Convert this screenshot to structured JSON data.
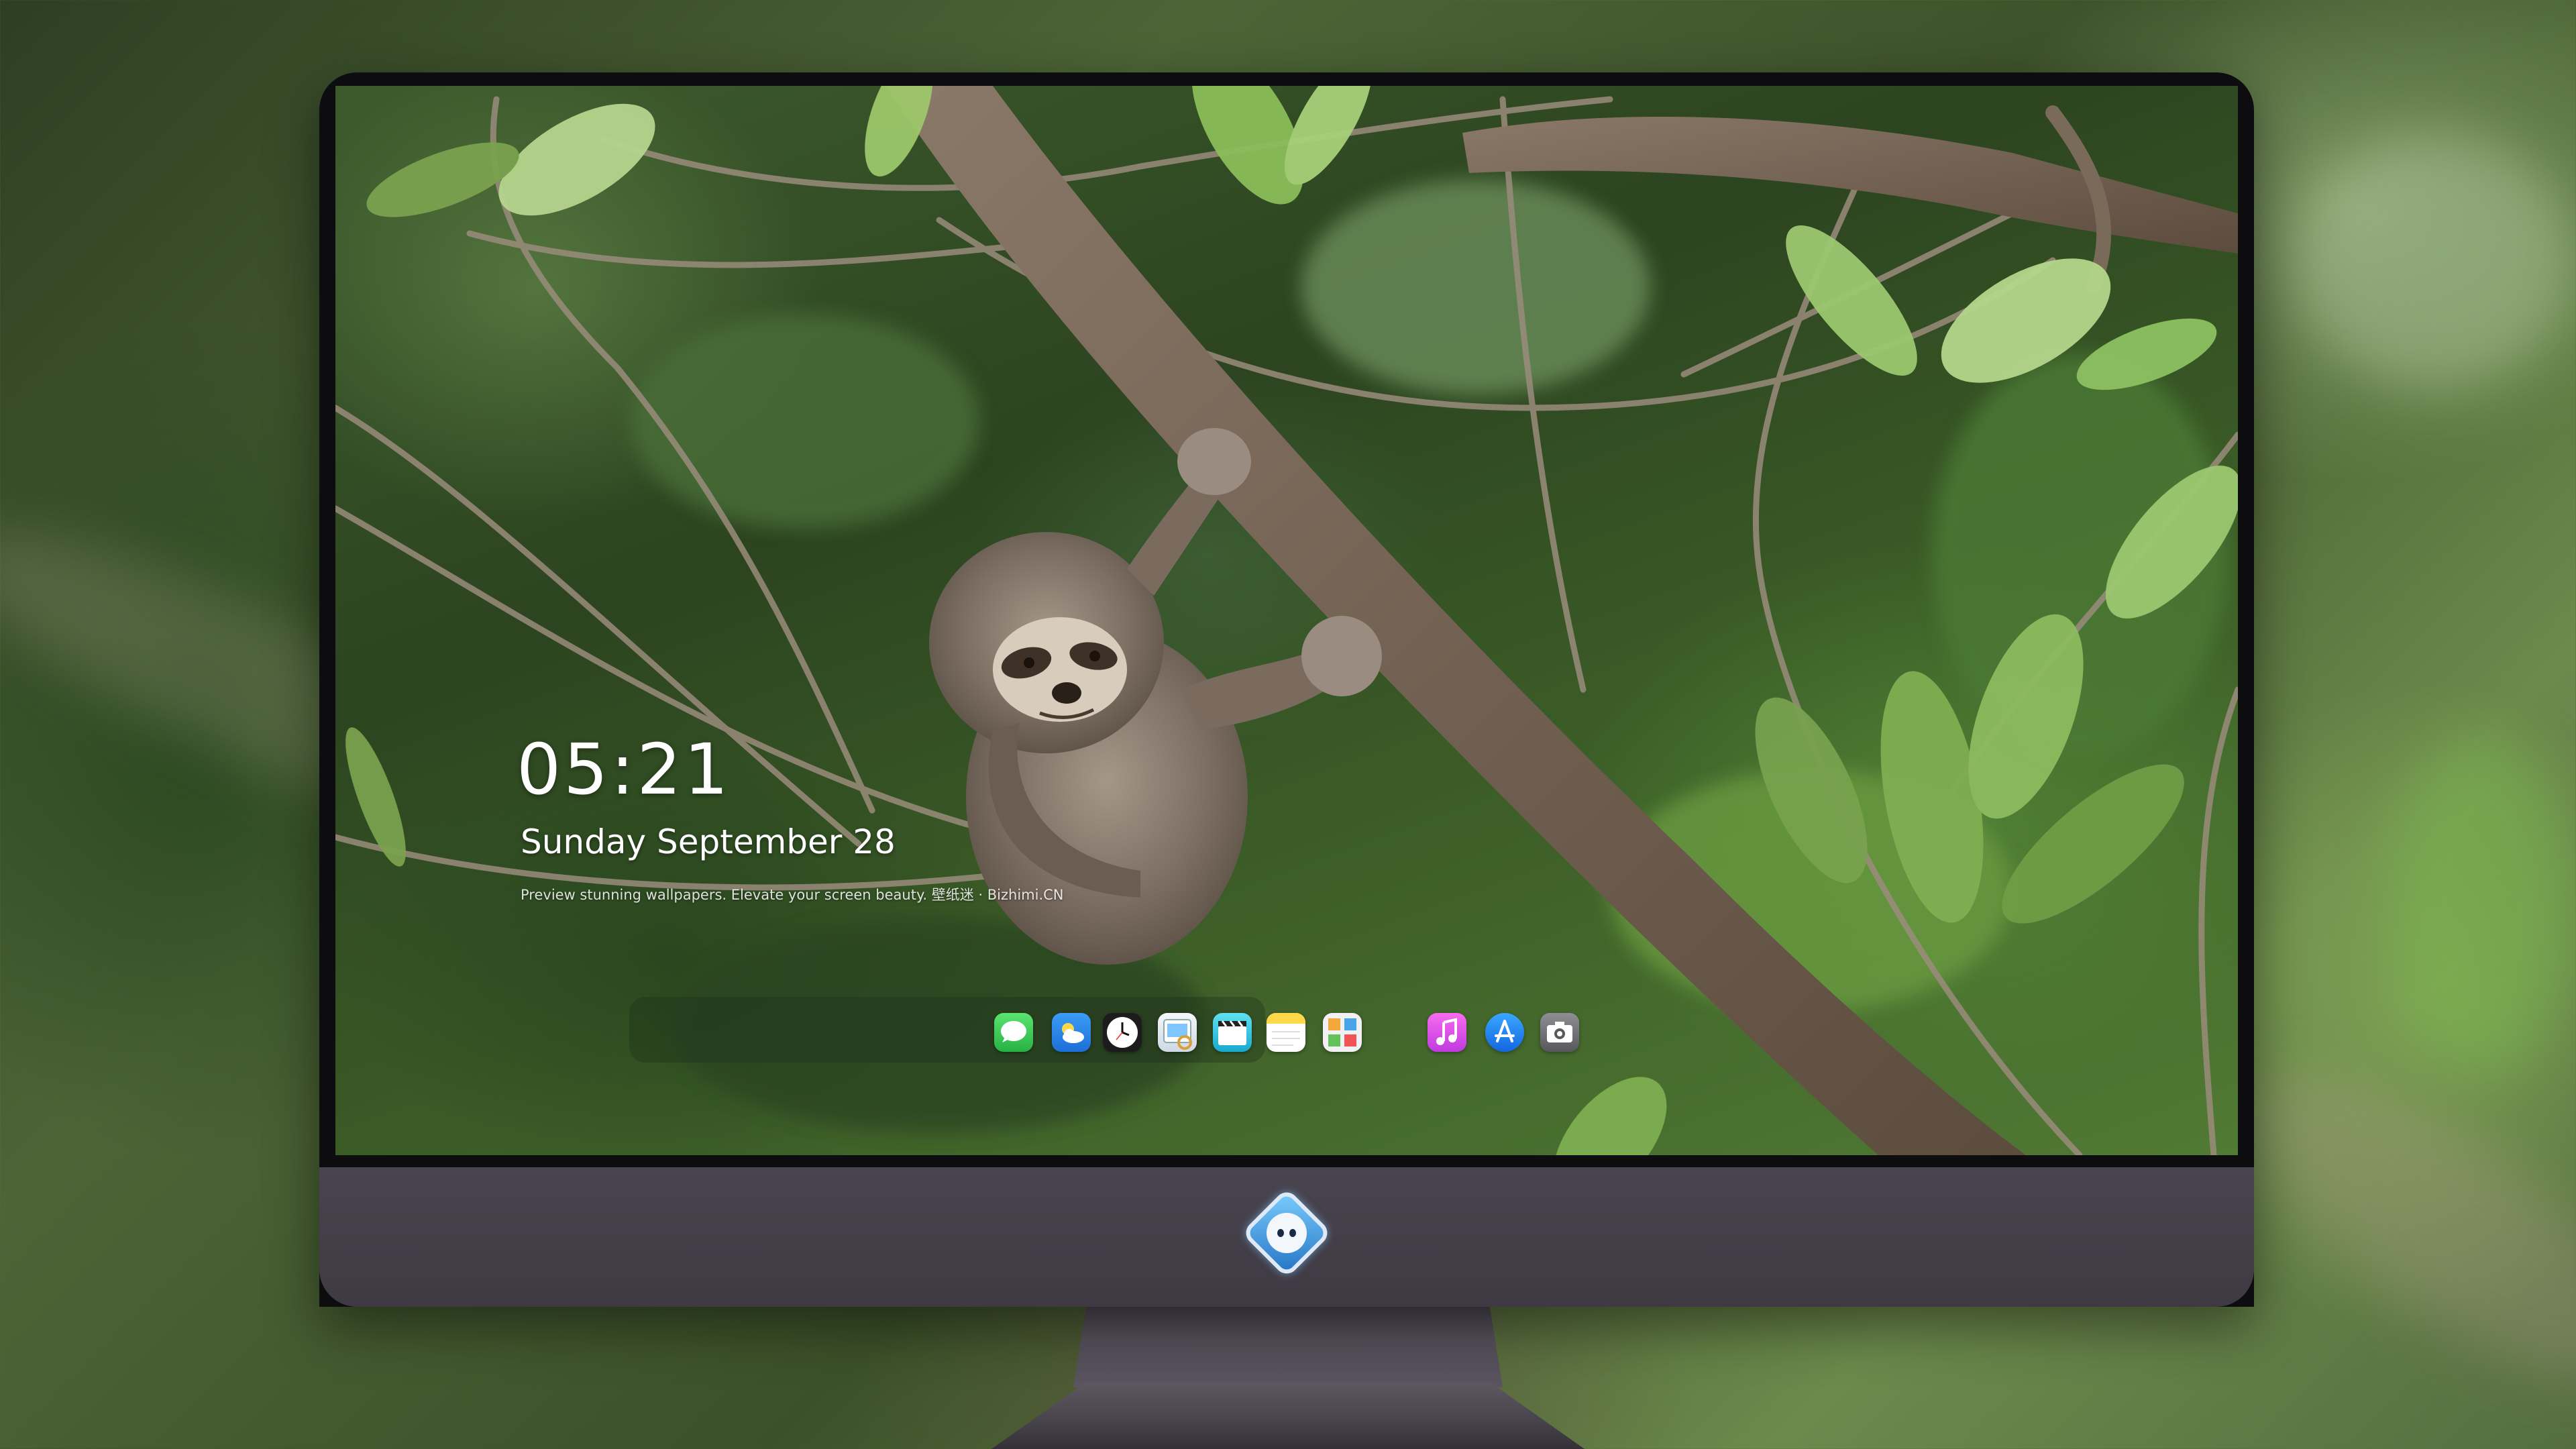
{
  "lock_screen": {
    "time": "05:21",
    "date": "Sunday September  28",
    "tagline": "Preview stunning wallpapers. Elevate your screen beauty. 壁纸迷 · Bizhimi.CN"
  },
  "dock": {
    "apps": [
      {
        "name": "Messages",
        "icon": "messages-icon",
        "color": "#34c759"
      },
      {
        "name": "Weather",
        "icon": "weather-icon",
        "color": "#2f8ff0"
      },
      {
        "name": "Clock",
        "icon": "clock-icon",
        "color": "#ffffff"
      },
      {
        "name": "Preview",
        "icon": "preview-icon",
        "color": "#e9eef5"
      },
      {
        "name": "Clips",
        "icon": "clips-icon",
        "color": "#27c4e0"
      },
      {
        "name": "Notes",
        "icon": "notes-icon",
        "color": "#ffd84a"
      },
      {
        "name": "Photo Booth",
        "icon": "photo-booth-icon",
        "color": "#e8e8ee"
      },
      {
        "name": "iTunes",
        "icon": "music-icon",
        "color": "#e84fd8"
      },
      {
        "name": "App Store",
        "icon": "app-store-icon",
        "color": "#1b8cf5"
      },
      {
        "name": "Screenshot",
        "icon": "camera-icon",
        "color": "#6e6e73"
      }
    ]
  },
  "colors": {
    "monitor_bezel": "#0d0d0f",
    "monitor_chin": "#46414b",
    "foliage_dark": "#2c4420",
    "leaf_light": "#7fae52",
    "branch": "#6a5a4a",
    "sloth_fur": "#7c6e62"
  },
  "wallpaper": {
    "subject": "sloth-on-branch"
  }
}
